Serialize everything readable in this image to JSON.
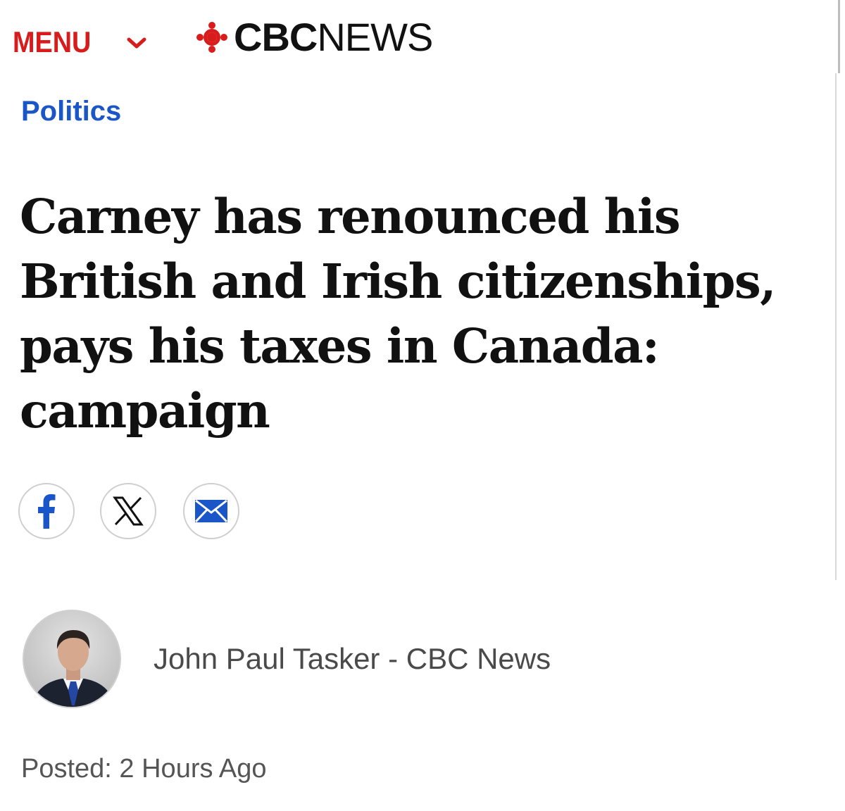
{
  "header": {
    "menu_label": "MENU",
    "logo_cbc": "CBC",
    "logo_news": "NEWS",
    "menu_color": "#d81b1b",
    "logo_gem_color": "#d81b1b"
  },
  "section": {
    "label": "Politics",
    "color": "#1a56c7"
  },
  "article": {
    "headline": "Carney has renounced his British and Irish citizenships, pays his taxes in Canada: campaign",
    "share_buttons": [
      {
        "name": "facebook",
        "icon": "facebook-icon",
        "color": "#1a56c7"
      },
      {
        "name": "x",
        "icon": "x-icon",
        "color": "#111111"
      },
      {
        "name": "email",
        "icon": "email-icon",
        "color": "#1a56c7"
      }
    ],
    "author": "John Paul Tasker - CBC News",
    "posted": "Posted: 2 Hours Ago"
  }
}
